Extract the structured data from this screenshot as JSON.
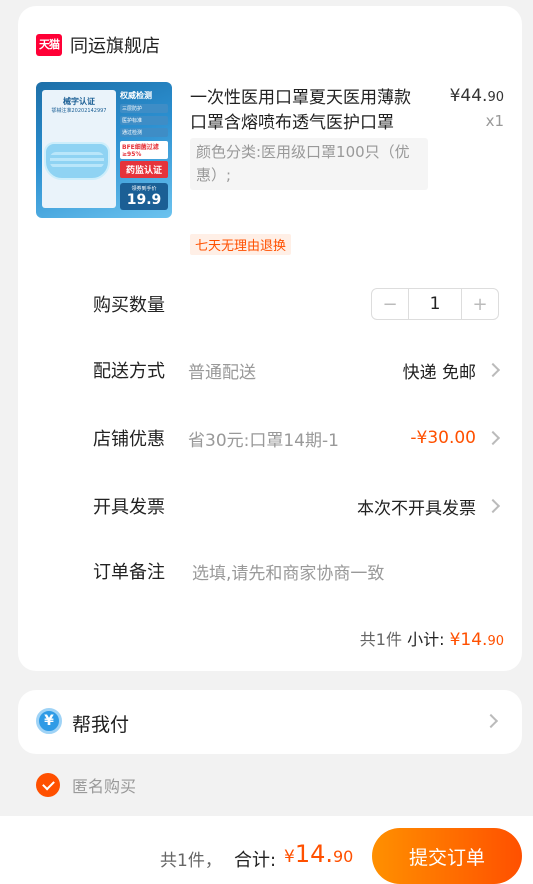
{
  "store": {
    "badge": "天猫",
    "name": "同运旗舰店"
  },
  "product": {
    "title": "一次性医用口罩夏天医用薄款口罩含熔喷布透气医护口罩",
    "price_main": "¥44.",
    "price_dec": "90",
    "quantity_label": "x1",
    "variant": "颜色分类:医用级口罩100只（优惠）;",
    "image_text": {
      "left_title": "械字认证",
      "left_sub": "鄂械注准20202142997",
      "right_title": "权威检测",
      "checks": [
        "三层防护",
        "医护标准",
        "通过检测"
      ],
      "bfe": "BFE细菌过滤≥95%",
      "cert": "药监认证",
      "price_label": "领券到手价",
      "price_value": "19.9"
    },
    "return_tag": "七天无理由退换"
  },
  "rows": {
    "quantity": {
      "label": "购买数量",
      "value": "1",
      "minus": "−",
      "plus": "+"
    },
    "delivery": {
      "label": "配送方式",
      "value": "普通配送",
      "right": "快递 免邮"
    },
    "discount": {
      "label": "店铺优惠",
      "value": "省30元:口罩14期-1",
      "right": "-¥30.00"
    },
    "invoice": {
      "label": "开具发票",
      "right": "本次不开具发票"
    },
    "note": {
      "label": "订单备注",
      "placeholder": "选填,请先和商家协商一致"
    }
  },
  "subtotal": {
    "count": "共1件",
    "label": "小计:",
    "currency": "¥",
    "amount_int": "14.",
    "amount_dec": "90"
  },
  "help_pay": {
    "icon": "¥",
    "label": "帮我付"
  },
  "anonymous": {
    "label": "匿名购买",
    "checked": true
  },
  "footer": {
    "count": "共1件，",
    "total_label": "合计:",
    "currency": "¥",
    "amount_int": "14.",
    "amount_dec": "90",
    "submit": "提交订单"
  },
  "colors": {
    "accent": "#ff5000",
    "tmall": "#ff0036",
    "help_blue": "#2e9be6"
  }
}
